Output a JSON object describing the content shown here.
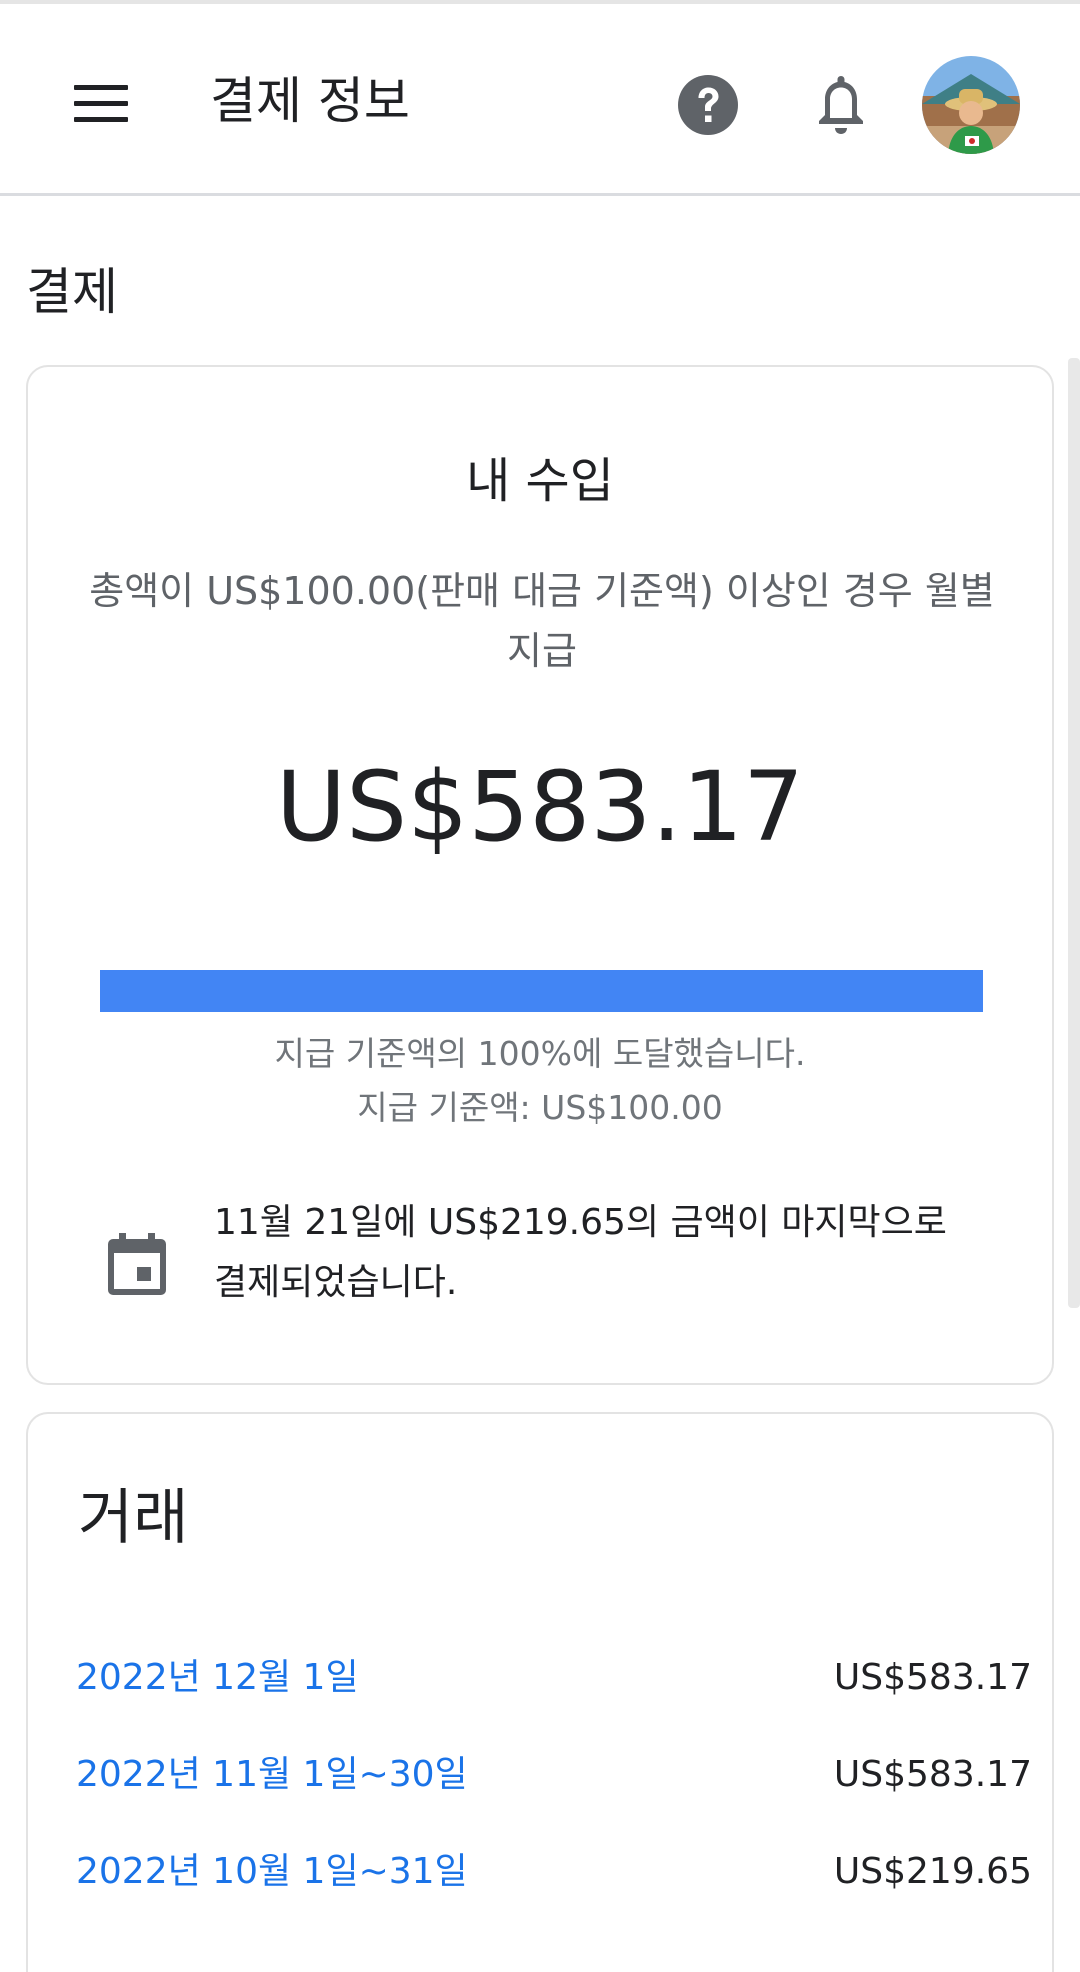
{
  "header": {
    "title": "결제 정보",
    "menu_icon": "hamburger-menu-icon",
    "help_icon": "help-circle-icon",
    "notification_icon": "bell-icon",
    "avatar_icon": "user-avatar"
  },
  "payments": {
    "section_title": "결제"
  },
  "earnings": {
    "title": "내 수입",
    "description": "총액이 US$100.00(판매 대금 기준액) 이상인 경우 월별 지급",
    "amount": "US$583.17",
    "progress_percent": 100,
    "progress_message": "지급 기준액의 100%에 도달했습니다.",
    "threshold_text": "지급 기준액: US$100.00",
    "last_payment_text": "11월 21일에 US$219.65의 금액이 마지막으로 결제되었습니다.",
    "calendar_icon": "calendar-icon"
  },
  "transactions": {
    "title": "거래",
    "items": [
      {
        "date": "2022년 12월 1일",
        "amount": "US$583.17"
      },
      {
        "date": "2022년 11월 1일~30일",
        "amount": "US$583.17"
      },
      {
        "date": "2022년 10월 1일~31일",
        "amount": "US$219.65"
      }
    ]
  },
  "colors": {
    "accent": "#4285f4",
    "link": "#1a73e8",
    "text_primary": "#202124",
    "text_secondary": "#5f6368"
  }
}
